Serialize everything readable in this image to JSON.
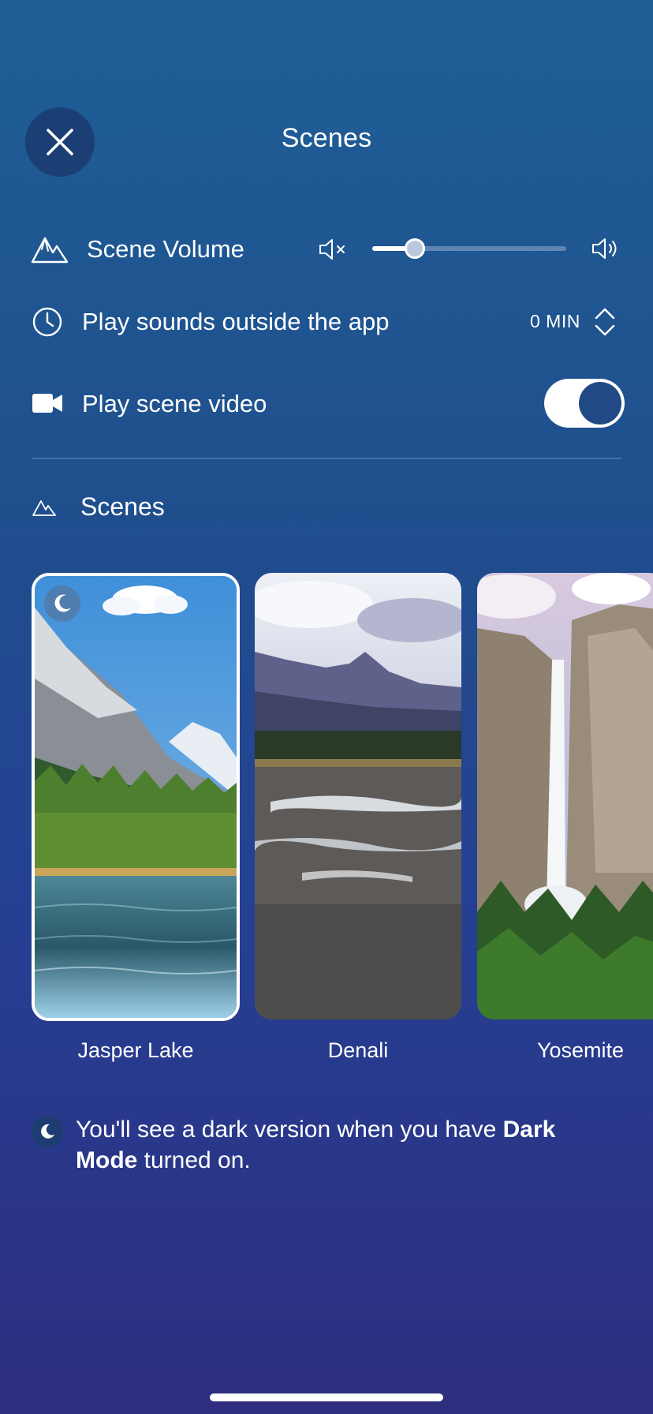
{
  "header": {
    "title": "Scenes"
  },
  "settings": {
    "volume_label": "Scene Volume",
    "volume_level": 0.22,
    "outside_label": "Play sounds outside the app",
    "outside_value": "0 MIN",
    "video_label": "Play scene video",
    "video_on": true
  },
  "scenes_section": {
    "heading": "Scenes",
    "items": [
      {
        "name": "Jasper Lake",
        "selected": true,
        "dark_mode_badge": true
      },
      {
        "name": "Denali",
        "selected": false
      },
      {
        "name": "Yosemite",
        "selected": false
      }
    ]
  },
  "footnote": {
    "part1": "You'll see a dark version when you have ",
    "bold": "Dark Mode",
    "part2": " turned on."
  },
  "colors": {
    "background_top": "#1f5f97",
    "background_bottom": "#2e2d7e",
    "close_button": "#1b3f74",
    "toggle_knob": "#204985"
  },
  "icons": {
    "close": "close-icon",
    "volume_section": "mountain-icon",
    "mute": "speaker-mute-icon",
    "loud": "speaker-loud-icon",
    "timer": "clock-icon",
    "stepper": "chevron-up-down-icon",
    "video": "video-camera-icon",
    "scenes_section": "mountain-icon",
    "dark_mode": "moon-icon"
  }
}
